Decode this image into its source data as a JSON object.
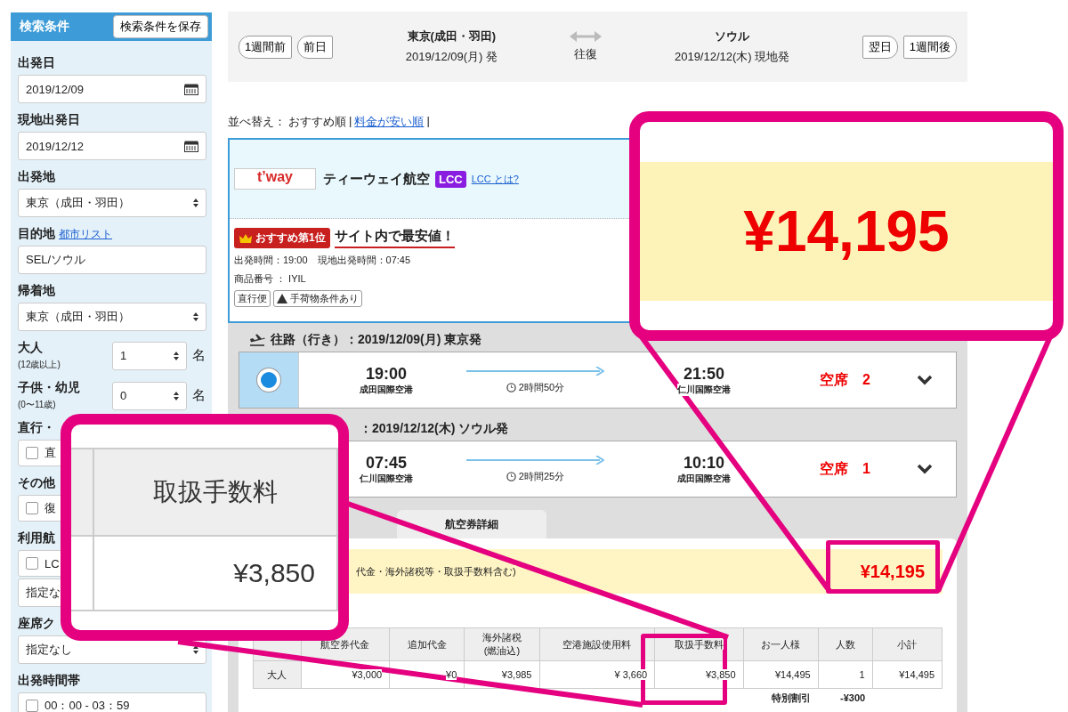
{
  "sidebar": {
    "title": "検索条件",
    "save_button": "検索条件を保存",
    "sections": [
      {
        "label": "出発日",
        "controls": [
          {
            "kind": "date",
            "value": "2019/12/09"
          }
        ]
      },
      {
        "label": "現地出発日",
        "controls": [
          {
            "kind": "date",
            "value": "2019/12/12"
          }
        ]
      },
      {
        "label": "出発地",
        "controls": [
          {
            "kind": "select",
            "value": "東京（成田・羽田）"
          }
        ]
      },
      {
        "label": "目的地",
        "link": "都市リスト",
        "controls": [
          {
            "kind": "text",
            "value": "SEL/ソウル"
          }
        ]
      },
      {
        "label": "帰着地",
        "controls": [
          {
            "kind": "select",
            "value": "東京（成田・羽田）"
          }
        ]
      },
      {
        "label": "大人",
        "sublabel": "(12歳以上)",
        "controls": [
          {
            "kind": "count",
            "value": "1",
            "unit": "名"
          }
        ]
      },
      {
        "label": "子供・幼児",
        "sublabel": "(0〜11歳)",
        "controls": [
          {
            "kind": "count",
            "value": "0",
            "unit": "名"
          }
        ]
      },
      {
        "label": "直行・",
        "controls": [
          {
            "kind": "checkbox",
            "value": "直",
            "checked": false
          }
        ]
      },
      {
        "label": "その他",
        "controls": [
          {
            "kind": "checkbox",
            "value": "復",
            "checked": false
          }
        ]
      },
      {
        "label": "利用航",
        "controls": [
          {
            "kind": "checkbox",
            "value": "LC",
            "checked": false
          },
          {
            "kind": "select",
            "value": "指定な"
          }
        ]
      },
      {
        "label": "座席ク",
        "controls": [
          {
            "kind": "select",
            "value": "指定なし"
          }
        ]
      },
      {
        "label": "出発時間帯",
        "controls": [
          {
            "kind": "checkbox",
            "value": "00：00 - 03：59",
            "checked": false
          }
        ]
      }
    ]
  },
  "nav": {
    "prev_buttons": [
      "1週間前",
      "前日"
    ],
    "origin": {
      "city": "東京(成田・羽田)",
      "date": "2019/12/09(月) 発"
    },
    "trip_type": "往復",
    "destination": {
      "city": "ソウル",
      "date": "2019/12/12(木) 現地発"
    },
    "next_buttons": [
      "翌日",
      "1週間後"
    ]
  },
  "sort": {
    "label": "並べ替え：",
    "separator": "|",
    "options": [
      {
        "label": "おすすめ順",
        "selected": true
      },
      {
        "label": "料金が安い順",
        "selected": false
      }
    ]
  },
  "result": {
    "logo": "t’way",
    "airline": "ティーウェイ航空",
    "badge": "LCC",
    "badge_link": "LCC とは?",
    "rank_badge": "おすすめ第1位",
    "headline": "サイト内で最安値！",
    "times": "出発時間：19:00　現地出発時間：07:45",
    "product": "商品番号 ： IYIL",
    "tags": [
      {
        "text": "直行便",
        "warning": false
      },
      {
        "text": "手荷物条件あり",
        "warning": true
      }
    ]
  },
  "segments": [
    {
      "header": "往路（行き）：2019/12/09(月) 東京発",
      "selected": true,
      "dep_time": "19:00",
      "dep_airport": "成田国際空港",
      "duration": "2時間50分",
      "arr_time": "21:50",
      "arr_airport": "仁川国際空港",
      "seats": "空席　2"
    },
    {
      "header": "：2019/12/12(木) ソウル発",
      "dep_time": "07:45",
      "dep_airport": "仁川国際空港",
      "duration": "2時間25分",
      "arr_time": "10:10",
      "arr_airport": "成田国際空港",
      "seats": "空席　1"
    }
  ],
  "tabs": [
    {
      "label": "航空券詳細",
      "selected": false
    }
  ],
  "price": {
    "note": "代金・海外諸税等・取扱手数料含む)",
    "total": "¥14,195"
  },
  "fare_table": {
    "columns": [
      "航空券代金",
      "追加代金",
      "海外諸税\n(燃油込)",
      "空港施設使用料",
      "取扱手数料",
      "お一人様",
      "人数",
      "小計"
    ],
    "rows": [
      {
        "label": "大人",
        "cells": [
          "¥3,000",
          "¥0",
          "¥3,985",
          "¥ 3,660",
          "¥3,850",
          "¥14,495",
          "1",
          "¥14,495"
        ]
      }
    ],
    "discount": {
      "label": "特別割引",
      "value": "-¥300"
    }
  },
  "callouts": [
    {
      "kind": "fee",
      "header": "取扱手数料",
      "value": "¥3,850"
    },
    {
      "kind": "price",
      "value": "¥14,195"
    }
  ]
}
